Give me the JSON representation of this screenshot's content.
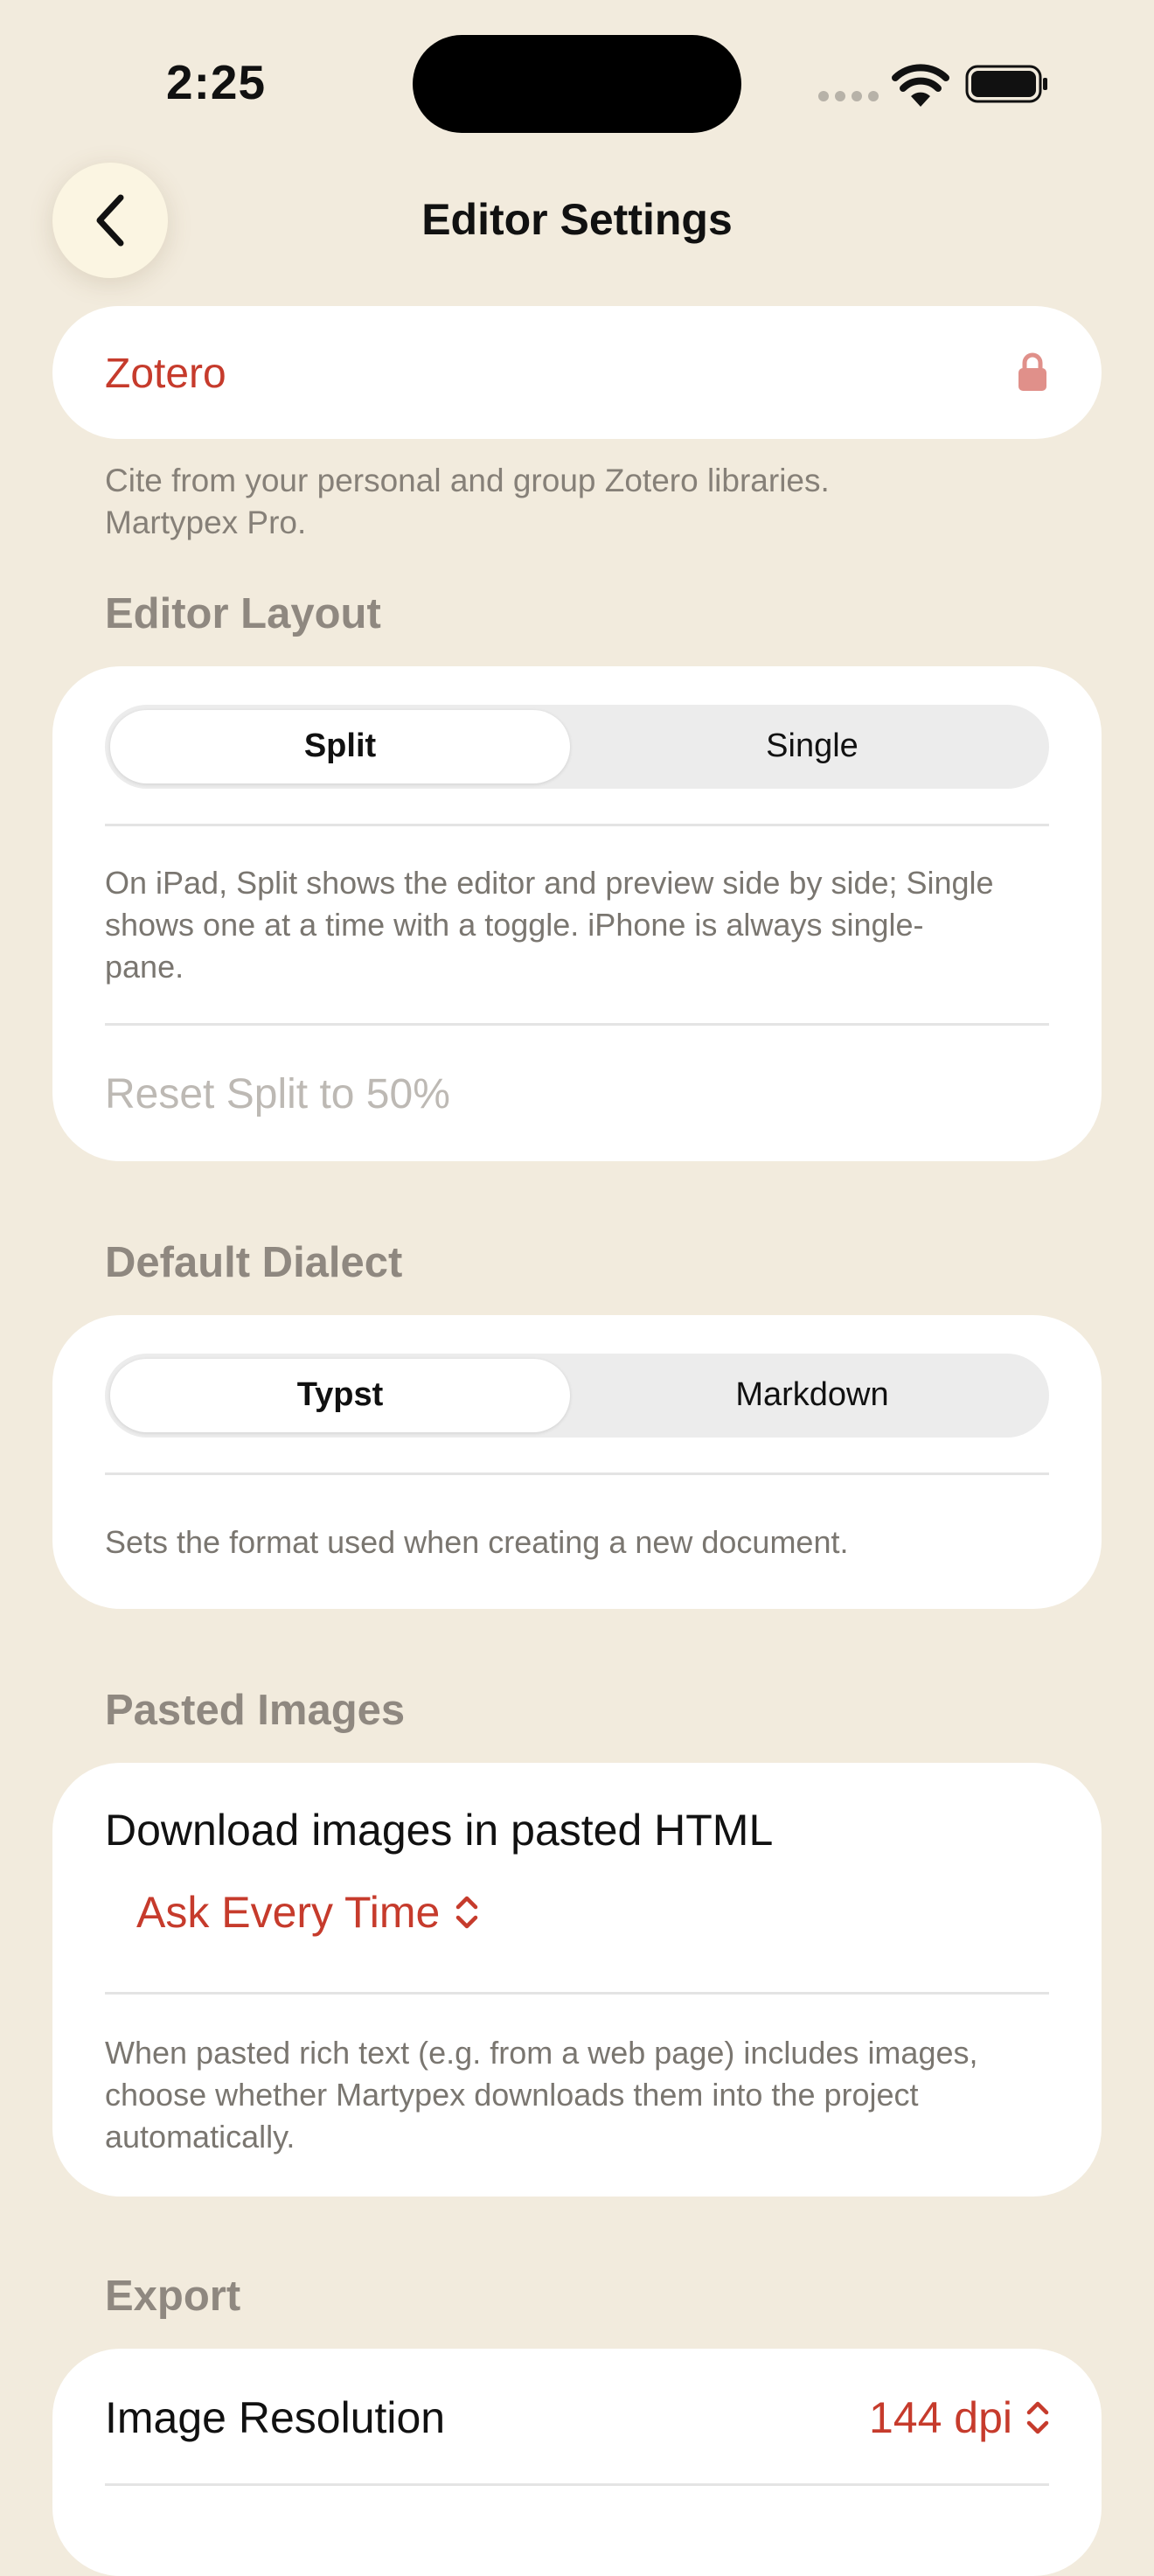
{
  "status_bar": {
    "time": "2:25"
  },
  "nav": {
    "title": "Editor Settings"
  },
  "colors": {
    "accent": "#c63b2c",
    "background": "#f2ebdd",
    "card": "#ffffff"
  },
  "zotero": {
    "label": "Zotero",
    "icon": "lock-icon",
    "description_line1": "Cite from your personal and group Zotero libraries.",
    "description_line2": "Martypex Pro."
  },
  "editor_layout": {
    "header": "Editor Layout",
    "segments": [
      "Split",
      "Single"
    ],
    "selected": "Split",
    "description_line1": "On iPad, Split shows the editor and preview side by side; Single",
    "description_line2": "shows one at a time with a toggle. iPhone is always single-",
    "description_line3": "pane.",
    "reset_label": "Reset Split to 50%"
  },
  "default_dialect": {
    "header": "Default Dialect",
    "segments": [
      "Typst",
      "Markdown"
    ],
    "selected": "Typst",
    "description": "Sets the format used when creating a new document."
  },
  "pasted_images": {
    "header": "Pasted Images",
    "row_label": "Download images in pasted HTML",
    "selected_option": "Ask Every Time",
    "description_line1": "When pasted rich text (e.g. from a web page) includes images,",
    "description_line2": "choose whether Martypex downloads them into the project",
    "description_line3": "automatically."
  },
  "export": {
    "header": "Export",
    "image_resolution_label": "Image Resolution",
    "image_resolution_value": "144 dpi"
  }
}
